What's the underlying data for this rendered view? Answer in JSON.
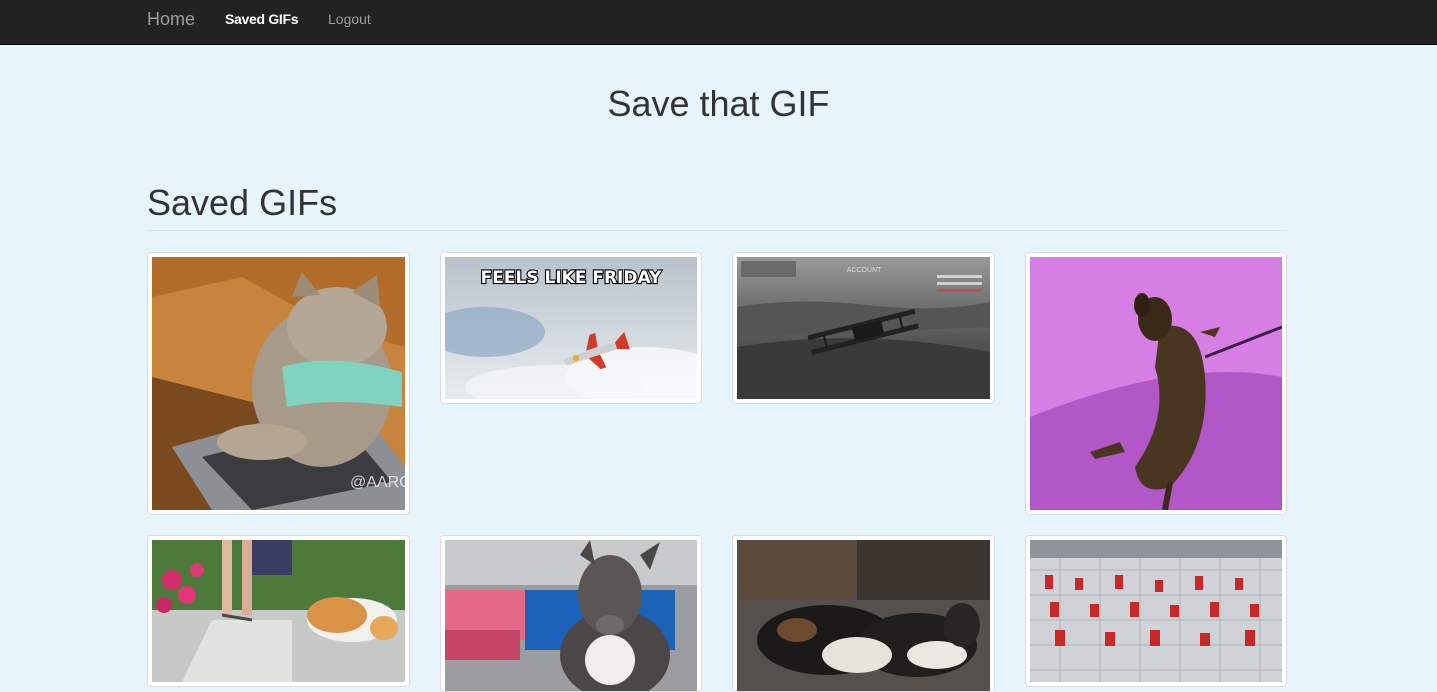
{
  "nav": {
    "brand": "Home",
    "saved": "Saved GIFs",
    "logout": "Logout"
  },
  "header": {
    "title": "Save that GIF"
  },
  "section": {
    "title": "Saved GIFs"
  },
  "gifs": [
    {
      "subject": "cat typing on laptop",
      "watermark": "@AARON"
    },
    {
      "subject": "toy plane in sky",
      "caption": "FEELS LIKE FRIDAY"
    },
    {
      "subject": "biplane flying game scene",
      "hud_text": "ACCOUNT"
    },
    {
      "subject": "dachshund rolling on purple floor"
    },
    {
      "subject": "corgi on sidewalk with flowers"
    },
    {
      "subject": "pit bull dog by blue wall"
    },
    {
      "subject": "basset hounds sleeping"
    },
    {
      "subject": "robot factory floor"
    }
  ],
  "colors": {
    "navbar": "#222222",
    "page_bg": "#e8f4fc",
    "heading": "#333333"
  }
}
